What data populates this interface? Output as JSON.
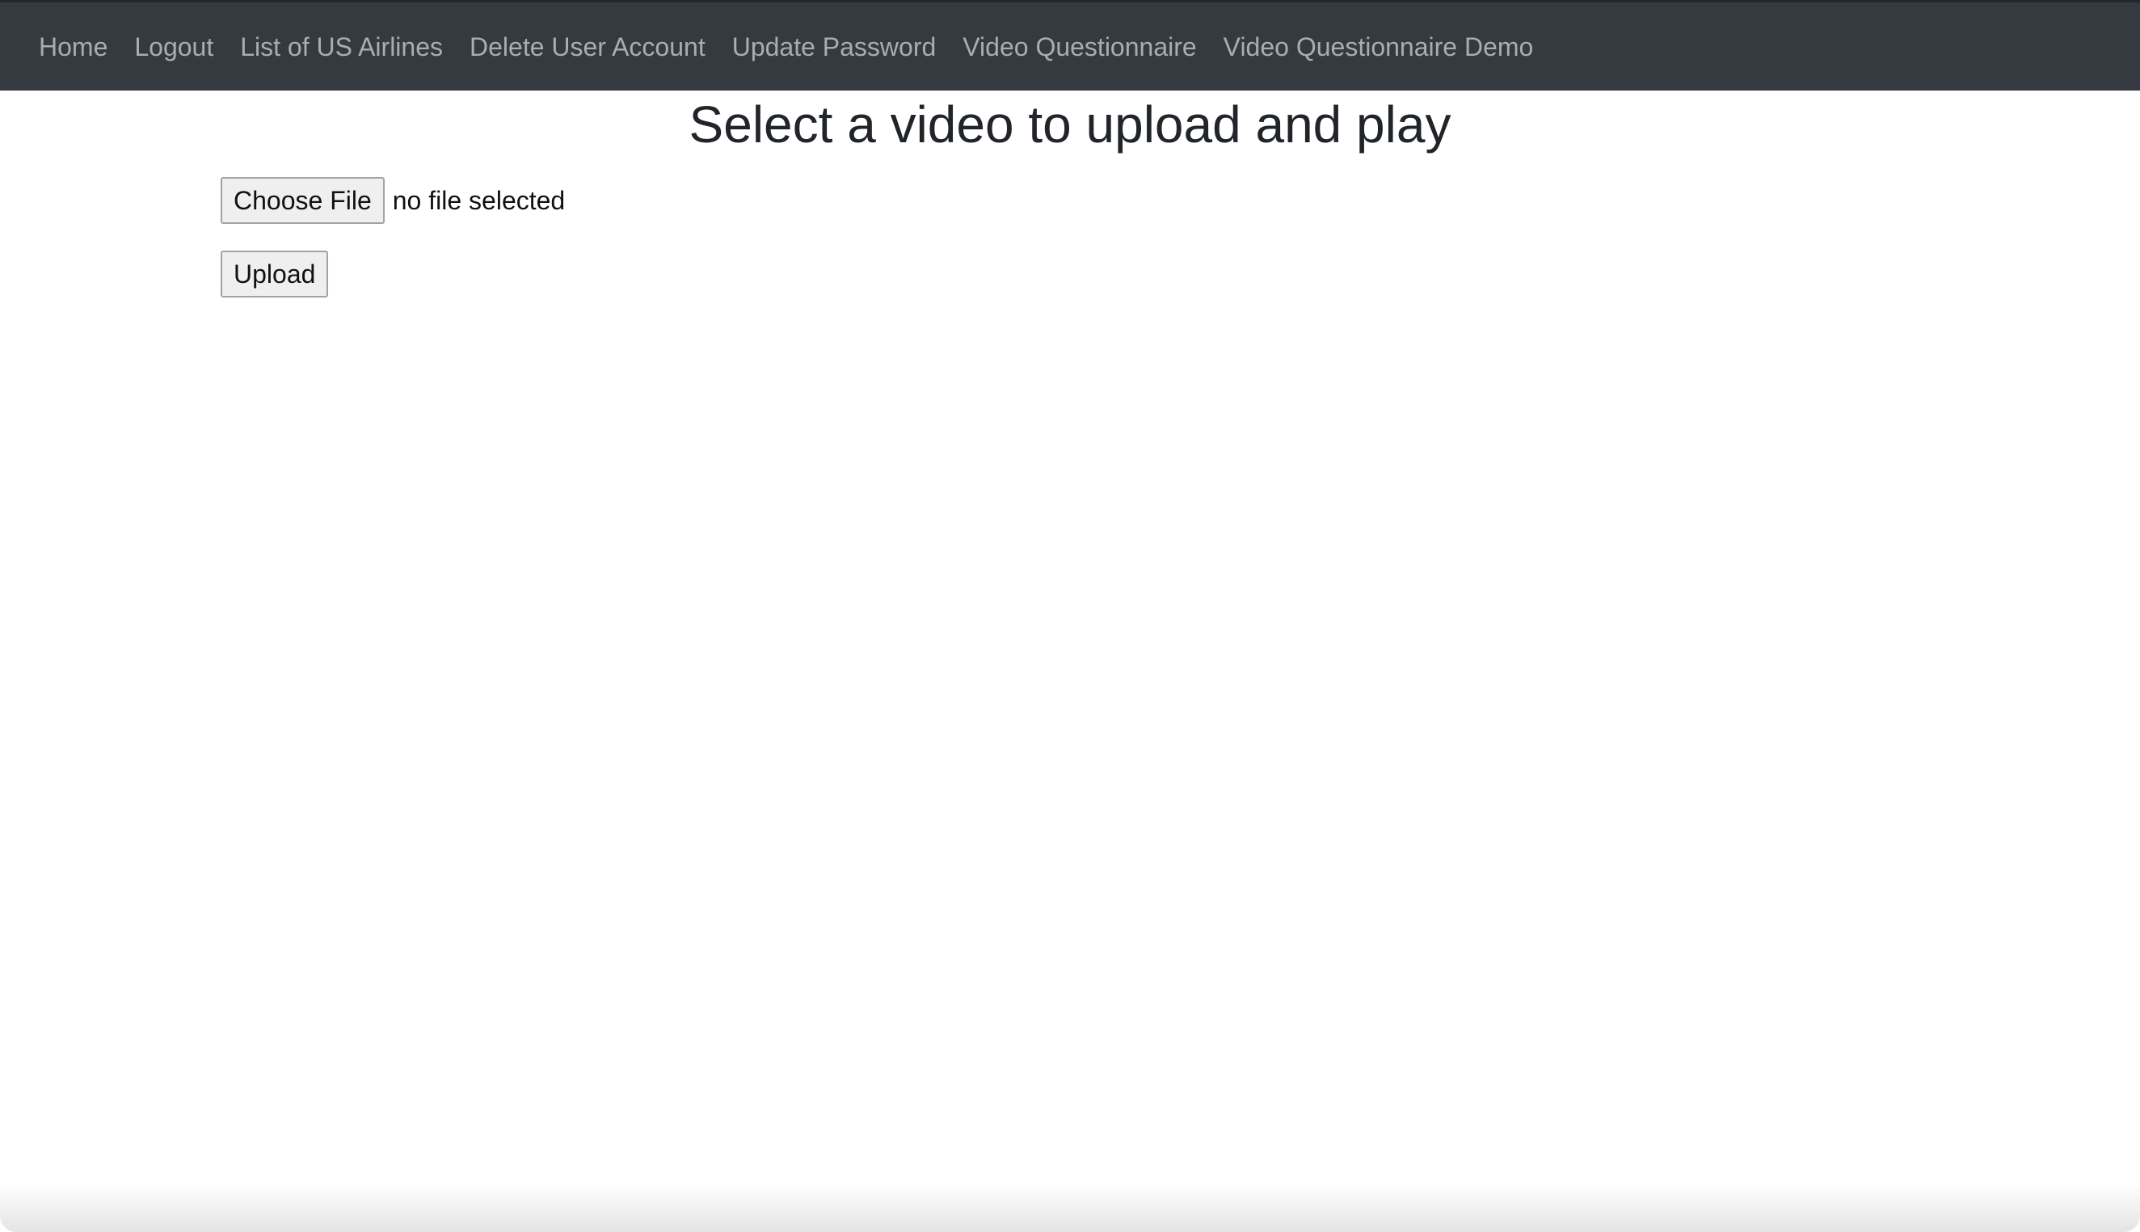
{
  "nav": {
    "items": [
      {
        "label": "Home"
      },
      {
        "label": "Logout"
      },
      {
        "label": "List of US Airlines"
      },
      {
        "label": "Delete User Account"
      },
      {
        "label": "Update Password"
      },
      {
        "label": "Video Questionnaire"
      },
      {
        "label": "Video Questionnaire Demo"
      }
    ]
  },
  "main": {
    "title": "Select a video to upload and play",
    "file_input": {
      "button_label": "Choose File",
      "status": "no file selected"
    },
    "upload_label": "Upload"
  },
  "colors": {
    "navbar_bg": "#343a40",
    "nav_link": "#a9adb1",
    "title_text": "#212529"
  }
}
